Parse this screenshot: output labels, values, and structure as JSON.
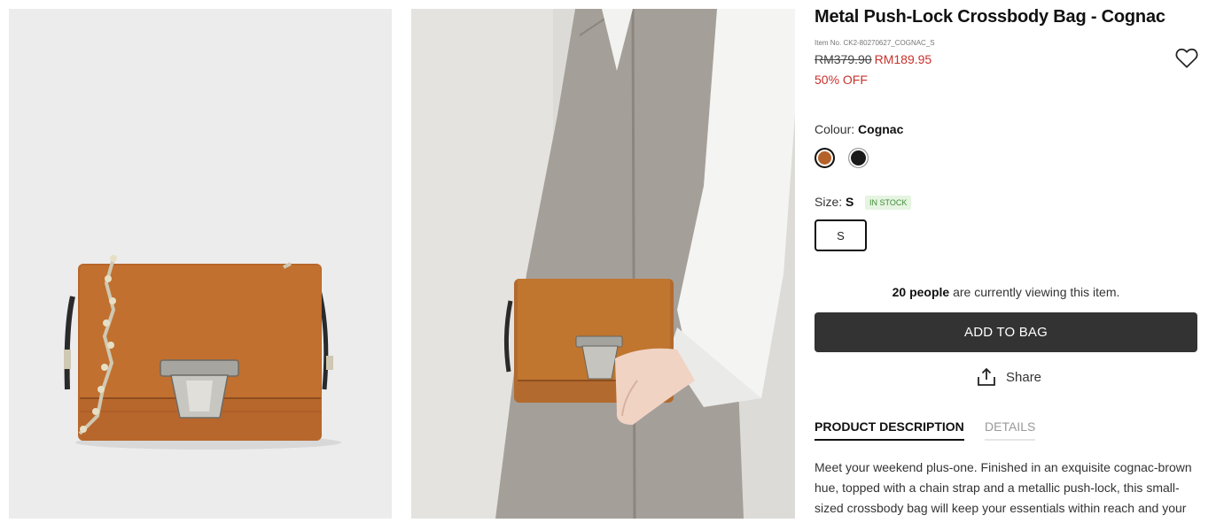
{
  "images": [
    {
      "name": "bag-front-view"
    },
    {
      "name": "bag-model-view"
    }
  ],
  "product": {
    "title": "Metal Push-Lock Crossbody Bag - Cognac",
    "item_no": "Item No. CK2-80270627_COGNAC_S",
    "old_price": "RM379.90",
    "new_price": "RM189.95",
    "discount": "50% OFF"
  },
  "colour": {
    "label": "Colour: ",
    "selected": "Cognac",
    "swatches": [
      {
        "name": "Cognac",
        "color": "#b4622a"
      },
      {
        "name": "Black",
        "color": "#1a1a1a"
      }
    ]
  },
  "size": {
    "label": "Size: ",
    "selected": "S",
    "stock": "IN STOCK",
    "options": [
      "S"
    ]
  },
  "viewing": {
    "count": "20 people",
    "text": " are currently viewing this item."
  },
  "actions": {
    "add_to_bag": "ADD TO BAG",
    "share": "Share"
  },
  "tabs": [
    {
      "label": "PRODUCT DESCRIPTION",
      "active": true
    },
    {
      "label": "DETAILS",
      "active": false
    }
  ],
  "description": "Meet your weekend plus-one. Finished in an exquisite cognac-brown hue, topped with a chain strap and a metallic push-lock, this small-sized crossbody bag will keep your essentials within reach and your style on",
  "icons": {
    "wishlist": "heart-outline-icon",
    "share": "share-upload-icon"
  },
  "colors": {
    "sale": "#c8312b",
    "button": "#333333",
    "in_stock_bg": "#e6f4e2",
    "in_stock_text": "#3e8e35"
  }
}
